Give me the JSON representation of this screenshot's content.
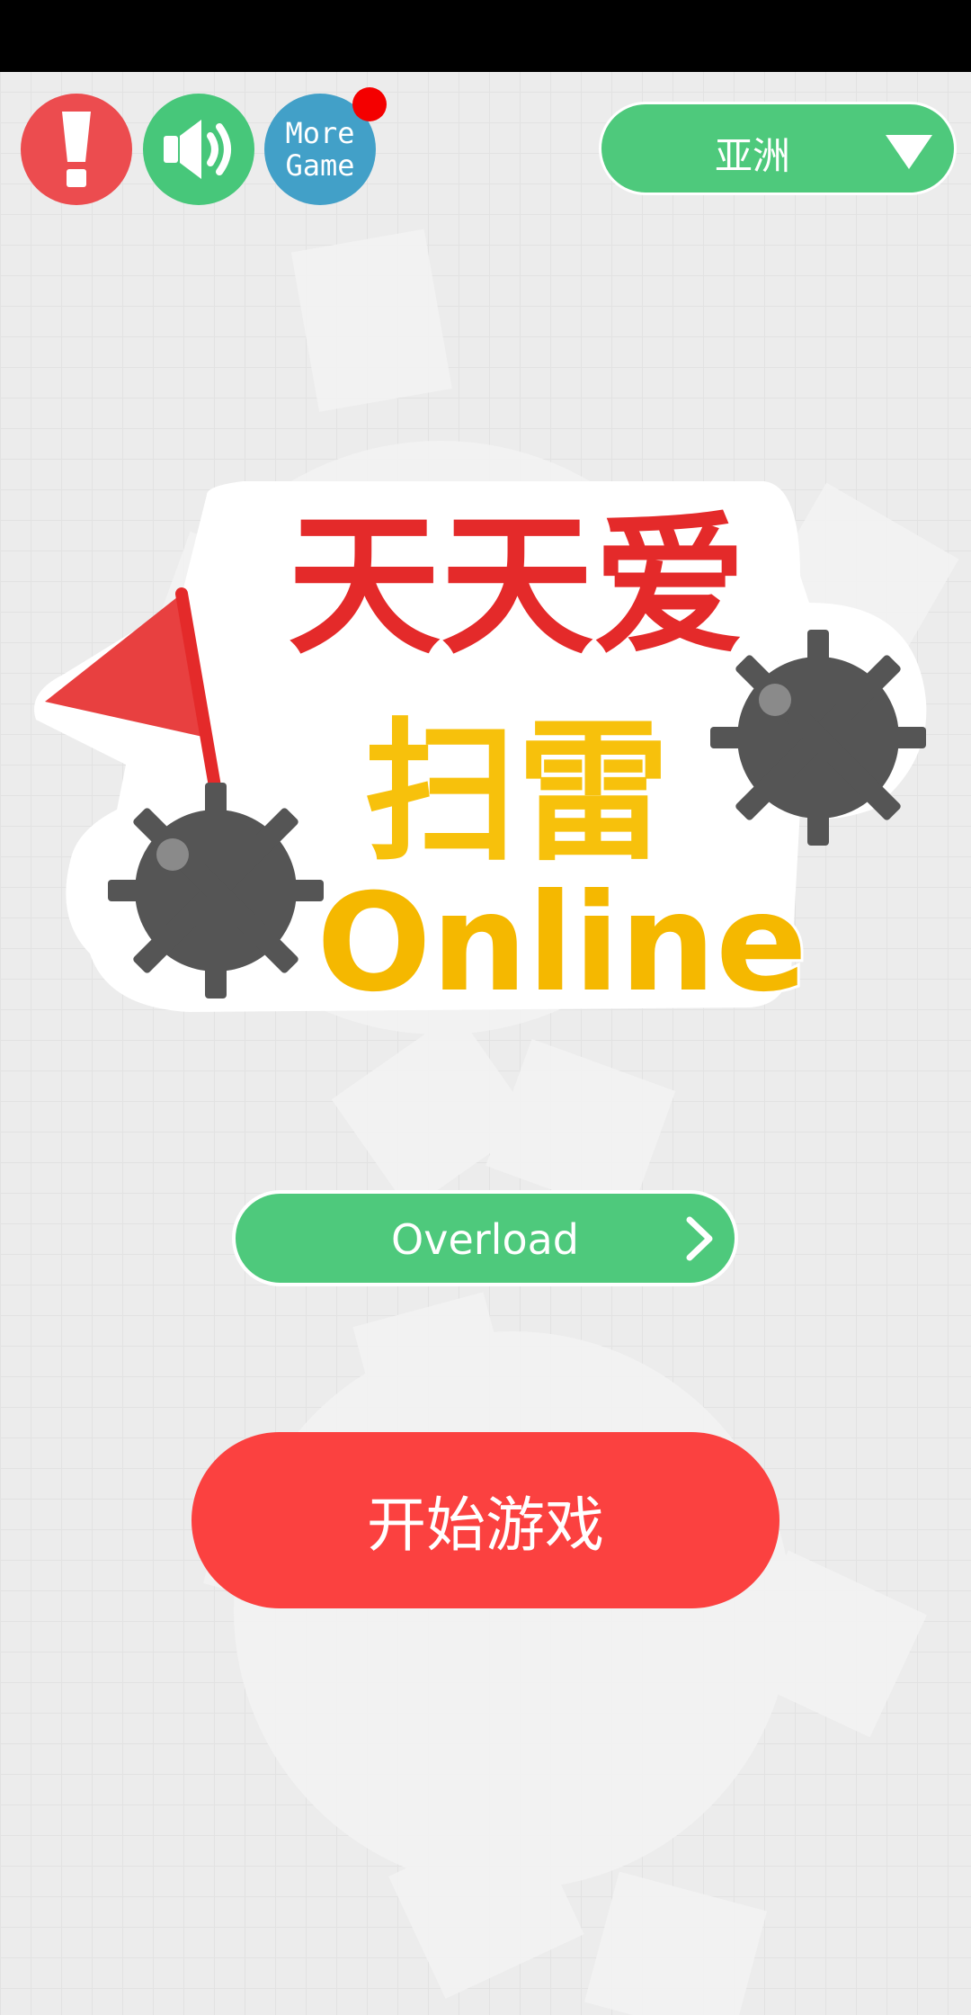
{
  "status_bar": {},
  "toolbar": {
    "info_icon": "exclamation-icon",
    "sound_icon": "speaker-icon",
    "more_game_line1": "More",
    "more_game_line2": "Game",
    "region_label": "亚洲"
  },
  "logo": {
    "line1": "天天爱",
    "line2": "扫雷",
    "line3": "Online"
  },
  "buttons": {
    "overload_label": "Overload",
    "start_label": "开始游戏"
  },
  "colors": {
    "green": "#4ec97c",
    "red": "#fb4140",
    "blue": "#42a0c8",
    "info_red": "#ec4c4f",
    "badge": "#f40000",
    "logo_red": "#e42a2a",
    "logo_yellow": "#f7c10c",
    "mine": "#555555"
  }
}
